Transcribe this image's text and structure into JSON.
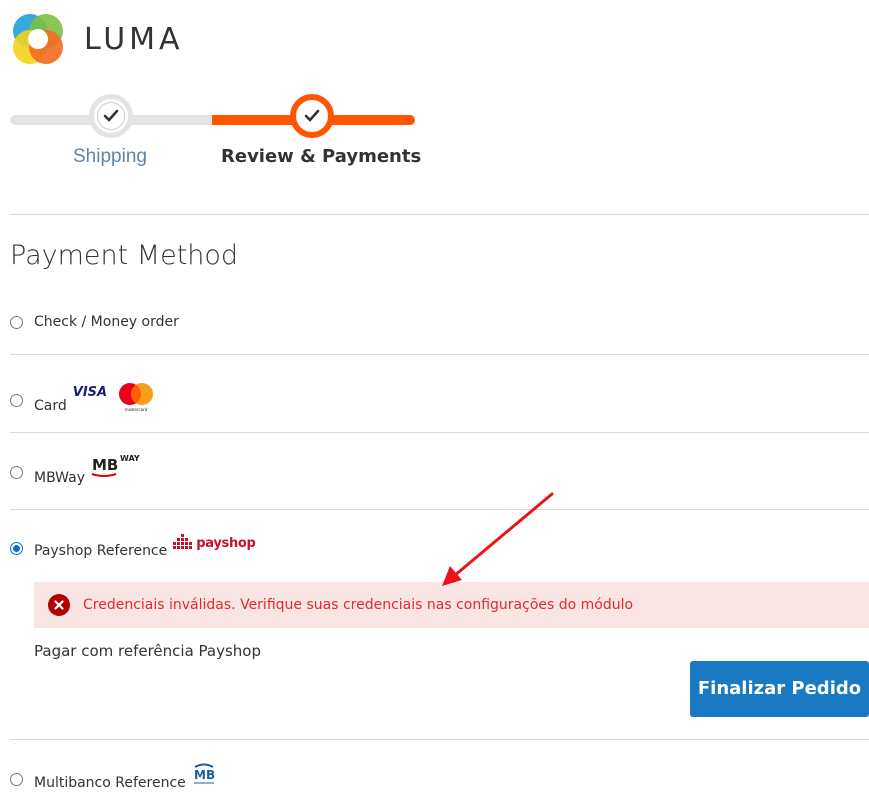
{
  "brand": {
    "name": "LUMA"
  },
  "progress": {
    "steps": [
      {
        "label": "Shipping",
        "status": "completed"
      },
      {
        "label": "Review & Payments",
        "status": "active"
      }
    ]
  },
  "payment": {
    "title": "Payment Method",
    "methods": [
      {
        "label": "Check / Money order",
        "selected": false
      },
      {
        "label": "Card",
        "selected": false,
        "logos": [
          "visa-logo",
          "mastercard-logo"
        ],
        "visa_text": "VISA",
        "mastercard_text": "mastercard"
      },
      {
        "label": "MBWay",
        "selected": false,
        "logos": [
          "mbway-logo"
        ],
        "mb_text": "MB",
        "way_text": "WAY"
      },
      {
        "label": "Payshop Reference",
        "selected": true,
        "logos": [
          "payshop-logo"
        ],
        "payshop_text": "payshop"
      },
      {
        "label": "Multibanco Reference",
        "selected": false,
        "logos": [
          "multibanco-logo"
        ],
        "mb_text": "MB"
      }
    ],
    "error": "Credenciais inválidas. Verifique suas credenciais nas configurações do módulo",
    "description": "Pagar com referência Payshop",
    "submit_label": "Finalizar Pedido"
  },
  "colors": {
    "accent_orange": "#ff5501",
    "button_blue": "#1979c3",
    "error_red": "#e02b27",
    "error_bg": "#fae5e5",
    "radio_blue": "#0b6dde"
  }
}
